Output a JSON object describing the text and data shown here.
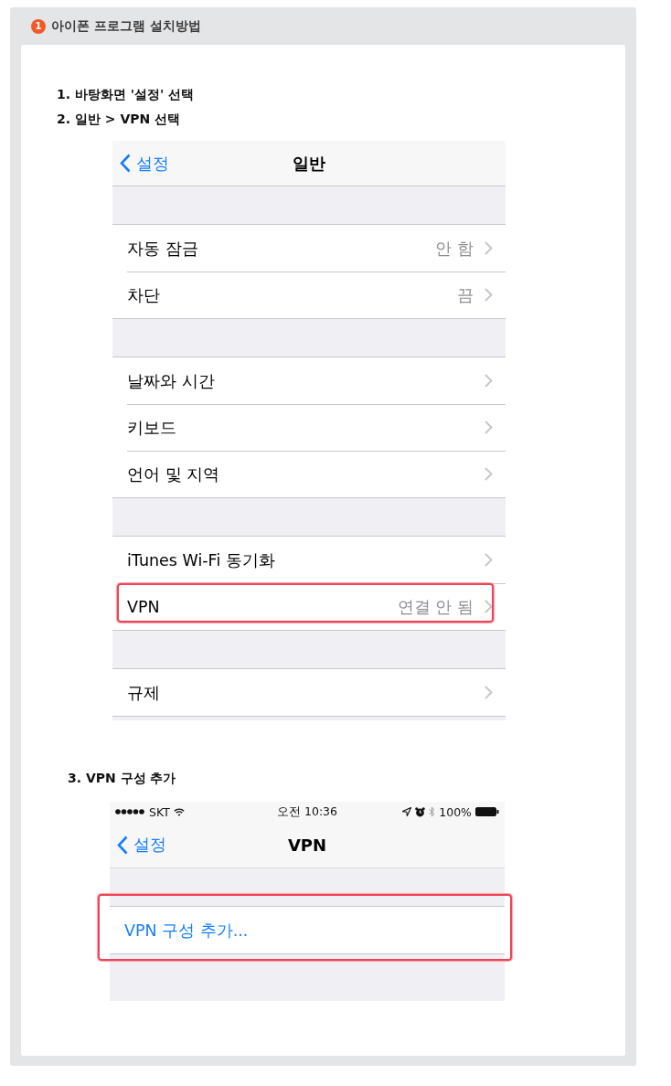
{
  "panel": {
    "badge": "1",
    "title": "아이폰 프로그램 설치방법"
  },
  "content": [
    {
      "kind": "step",
      "text": "1. 바탕화면 '설정' 선택"
    },
    {
      "kind": "step",
      "text": "2. 일반 > VPN 선택"
    },
    {
      "kind": "screenshot",
      "nav": {
        "back": "설정",
        "title": "일반"
      },
      "groups": [
        {
          "rows": [
            {
              "kind": "disclosure",
              "label": "자동 잠금",
              "value": "안 함",
              "highlighted": false
            },
            {
              "kind": "disclosure",
              "label": "차단",
              "value": "끔",
              "highlighted": false
            }
          ]
        },
        {
          "rows": [
            {
              "kind": "disclosure",
              "label": "날짜와 시간",
              "highlighted": false
            },
            {
              "kind": "disclosure",
              "label": "키보드",
              "highlighted": false
            },
            {
              "kind": "disclosure",
              "label": "언어 및 지역",
              "highlighted": false
            }
          ]
        },
        {
          "rows": [
            {
              "kind": "disclosure",
              "label": "iTunes Wi-Fi 동기화",
              "highlighted": false
            },
            {
              "kind": "disclosure",
              "label": "VPN",
              "value": "연결 안 됨",
              "highlighted": true
            }
          ]
        },
        {
          "rows": [
            {
              "kind": "disclosure",
              "label": "규제",
              "highlighted": false
            }
          ]
        }
      ]
    },
    {
      "kind": "step",
      "text": "3. VPN 구성 추가"
    },
    {
      "kind": "screenshot",
      "status_bar": {
        "carrier": "SKT",
        "time": "오전 10:36",
        "battery": "100%"
      },
      "nav": {
        "back": "설정",
        "title": "VPN"
      },
      "groups": [
        {
          "rows": [
            {
              "kind": "action",
              "label": "VPN 구성 추가...",
              "highlighted": true
            }
          ]
        }
      ]
    }
  ]
}
